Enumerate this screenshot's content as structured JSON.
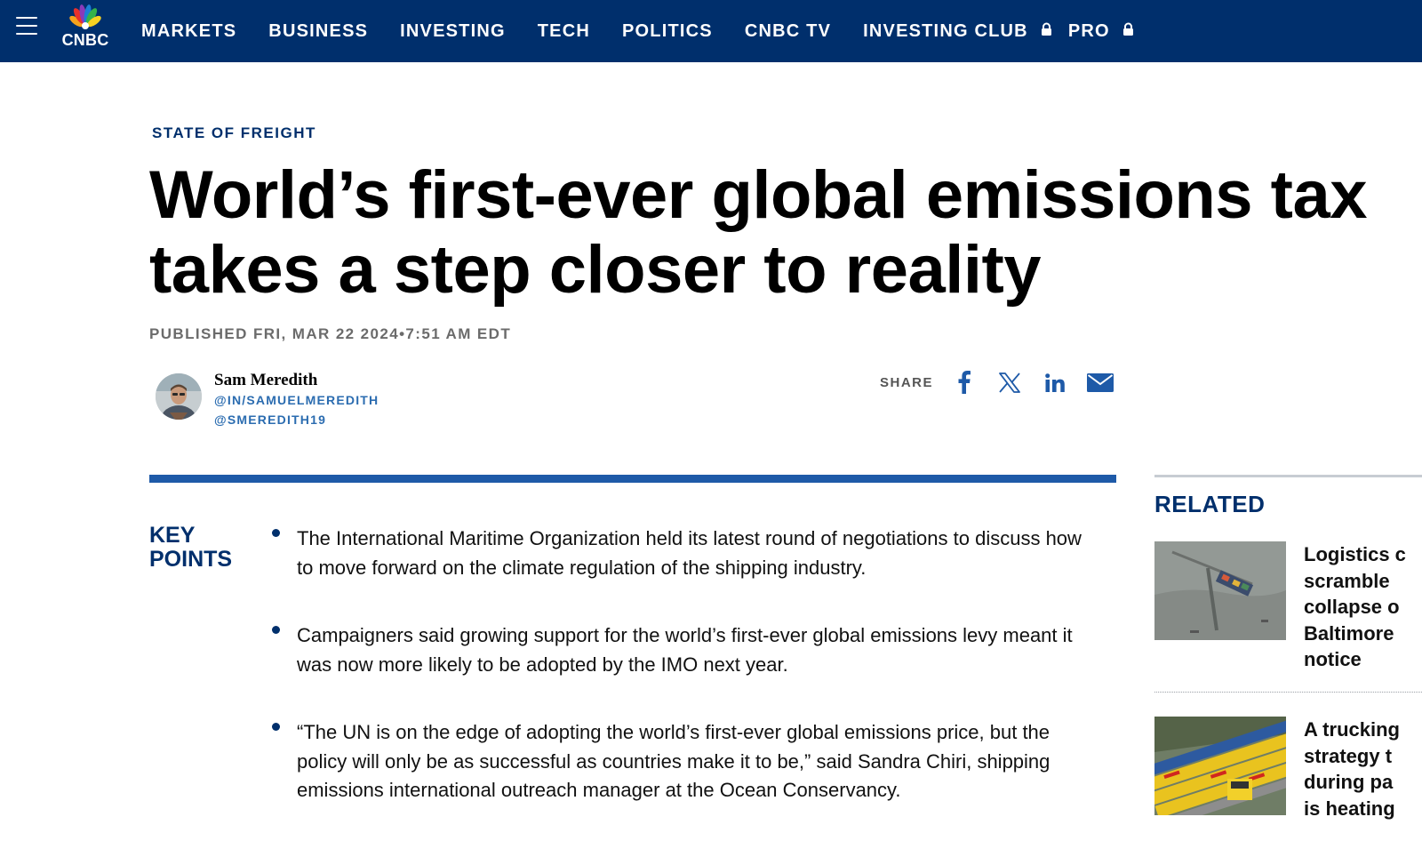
{
  "nav": {
    "logo_text": "CNBC",
    "items": [
      {
        "label": "MARKETS",
        "locked": false
      },
      {
        "label": "BUSINESS",
        "locked": false
      },
      {
        "label": "INVESTING",
        "locked": false
      },
      {
        "label": "TECH",
        "locked": false
      },
      {
        "label": "POLITICS",
        "locked": false
      },
      {
        "label": "CNBC TV",
        "locked": false
      },
      {
        "label": "INVESTING CLUB",
        "locked": true
      },
      {
        "label": "PRO",
        "locked": true
      }
    ],
    "icons": {
      "menu": "hamburger-menu-icon",
      "lock": "lock-icon"
    }
  },
  "article": {
    "kicker": "STATE OF FREIGHT",
    "headline_line1": "World’s first-ever global emissions tax",
    "headline_line2": "takes a step closer to reality",
    "published": "PUBLISHED FRI, MAR 22 2024•7:51 AM EDT",
    "author": {
      "name": "Sam Meredith",
      "linkedin": "@IN/SAMUELMEREDITH",
      "twitter": "@SMEREDITH19"
    },
    "share": {
      "label": "SHARE",
      "buttons": [
        "facebook-icon",
        "x-icon",
        "linkedin-icon",
        "email-icon"
      ]
    },
    "key_points": {
      "title_line1": "KEY",
      "title_line2": "POINTS",
      "items": [
        "The International Maritime Organization held its latest round of negotiations to discuss how to move forward on the climate regulation of the shipping industry.",
        "Campaigners said growing support for the world’s first-ever global emissions levy meant it was now more likely to be adopted by the IMO next year.",
        "“The UN is on the edge of adopting the world’s first-ever global emissions price, but the policy will only be as successful as countries make it to be,” said Sandra Chiri, shipping emissions international outreach manager at the Ocean Conservancy."
      ]
    }
  },
  "related": {
    "title": "RELATED",
    "items": [
      {
        "lines": [
          "Logistics c",
          "scramble",
          "collapse o",
          "Baltimore",
          "notice"
        ]
      },
      {
        "lines": [
          "A trucking",
          "strategy t",
          "during pa",
          "is heating"
        ]
      }
    ]
  },
  "colors": {
    "navy": "#002f6c",
    "accent_blue": "#1e5aa8",
    "link_blue": "#2b6cb0",
    "facebook_blue": "#1877f2"
  }
}
